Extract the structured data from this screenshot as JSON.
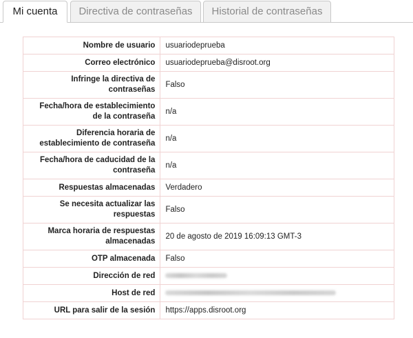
{
  "tabs": [
    {
      "label": "Mi cuenta",
      "active": true
    },
    {
      "label": "Directiva de contraseñas",
      "active": false
    },
    {
      "label": "Historial de contraseñas",
      "active": false
    }
  ],
  "rows": [
    {
      "label": "Nombre de usuario",
      "value": "usuariodeprueba"
    },
    {
      "label": "Correo electrónico",
      "value": "usuariodeprueba@disroot.org"
    },
    {
      "label": "Infringe la directiva de contraseñas",
      "value": "Falso"
    },
    {
      "label": "Fecha/hora de establecimiento de la contraseña",
      "value": "n/a"
    },
    {
      "label": "Diferencia horaria de establecimiento de contraseña",
      "value": "n/a"
    },
    {
      "label": "Fecha/hora de caducidad de la contraseña",
      "value": "n/a"
    },
    {
      "label": "Respuestas almacenadas",
      "value": "Verdadero"
    },
    {
      "label": "Se necesita actualizar las respuestas",
      "value": "Falso"
    },
    {
      "label": "Marca horaria de respuestas almacenadas",
      "value": "20 de agosto de 2019 16:09:13 GMT-3"
    },
    {
      "label": "OTP almacenada",
      "value": "Falso"
    },
    {
      "label": "Dirección de red",
      "value": ""
    },
    {
      "label": "Host de red",
      "value": ""
    },
    {
      "label": "URL para salir de la sesión",
      "value": "https://apps.disroot.org"
    }
  ]
}
